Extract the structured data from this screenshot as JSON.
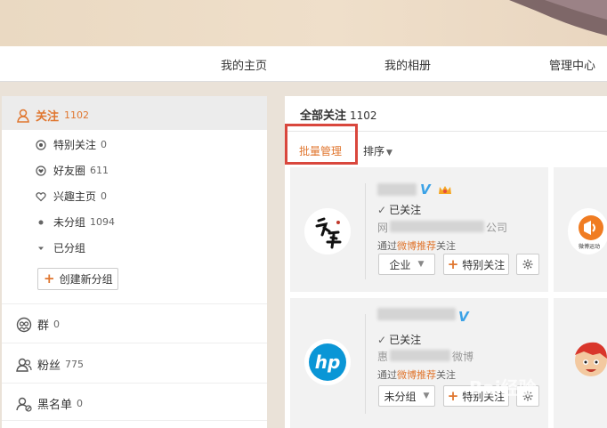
{
  "nav": {
    "items": [
      "我的主页",
      "我的相册",
      "管理中心"
    ]
  },
  "sidebar": {
    "follow": {
      "label": "关注",
      "count": "1102"
    },
    "sub_items": [
      {
        "label": "特别关注",
        "count": "0"
      },
      {
        "label": "好友圈",
        "count": "611"
      },
      {
        "label": "兴趣主页",
        "count": "0"
      },
      {
        "label": "未分组",
        "count": "1094"
      },
      {
        "label": "已分组",
        "count": ""
      }
    ],
    "create_group_label": "创建新分组",
    "groups": {
      "label": "群",
      "count": "0"
    },
    "fans": {
      "label": "粉丝",
      "count": "775"
    },
    "blacklist": {
      "label": "黑名单",
      "count": "0"
    }
  },
  "main": {
    "title": "全部关注",
    "count": "1102",
    "batch_label": "批量管理",
    "sort_label": "排序"
  },
  "cards": [
    {
      "status": "已关注",
      "info_prefix": "网",
      "info_suffix": "公司",
      "via_prefix": "通过",
      "via_source": "微博推荐",
      "via_suffix": "关注",
      "group_label": "企业",
      "special_label": "特别关注"
    },
    {
      "status": "已关注",
      "info_prefix": "惠",
      "info_suffix": "微博",
      "via_prefix": "通过",
      "via_source": "微博推荐",
      "via_suffix": "关注",
      "group_label": "未分组",
      "special_label": "特别关注"
    }
  ],
  "peek_card": {
    "caption": "微博运动"
  },
  "watermark": "Bai经验",
  "colors": {
    "accent": "#e0762f",
    "verified": "#3ba2e6",
    "highlight_box": "#d9473d",
    "page_bg": "#eae2d8"
  }
}
